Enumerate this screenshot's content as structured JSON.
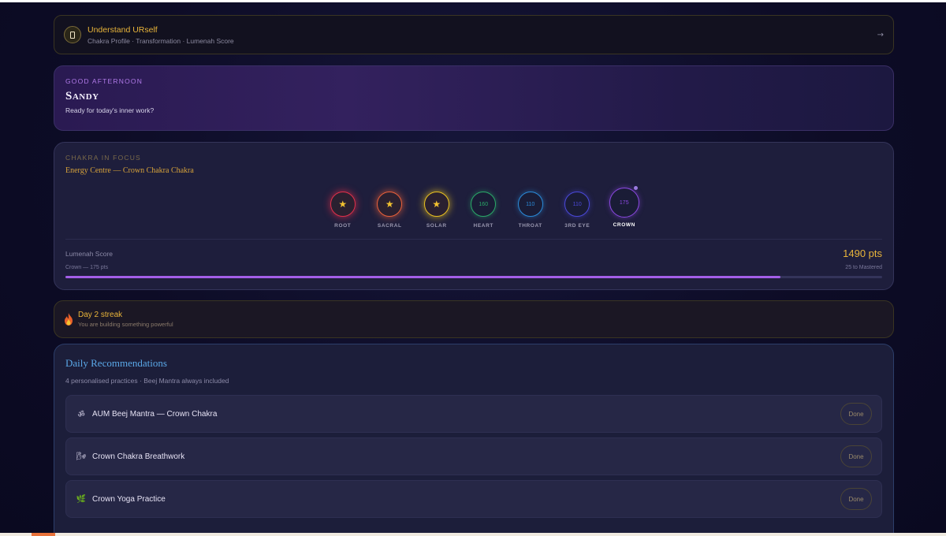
{
  "banner": {
    "title": "Understand URself",
    "subtitle": "Chakra Profile · Transformation · Lumenah Score",
    "arrow": "→"
  },
  "greeting": {
    "label": "GOOD AFTERNOON",
    "name": "Sandy",
    "subtitle": "Ready for today's inner work?"
  },
  "chakra_focus": {
    "label": "CHAKRA IN FOCUS",
    "subtitle": "Energy Centre — Crown Chakra Chakra",
    "chakras": [
      {
        "name": "ROOT",
        "value": "★",
        "color": "#e0304a",
        "mastered": true
      },
      {
        "name": "SACRAL",
        "value": "★",
        "color": "#e8603a",
        "mastered": true
      },
      {
        "name": "SOLAR",
        "value": "★",
        "color": "#e8c020",
        "mastered": true
      },
      {
        "name": "HEART",
        "value": "160",
        "color": "#2aa868",
        "mastered": false
      },
      {
        "name": "THROAT",
        "value": "110",
        "color": "#2a8ad8",
        "mastered": false
      },
      {
        "name": "3RD EYE",
        "value": "110",
        "color": "#4a48d8",
        "mastered": false
      },
      {
        "name": "CROWN",
        "value": "175",
        "color": "#8a48e0",
        "mastered": false,
        "active": true
      }
    ],
    "score_label": "Lumenah Score",
    "score_value": "1490 pts",
    "current": "Crown — 175 pts",
    "to_mastered": "25 to Mastered",
    "progress": 0.875
  },
  "streak": {
    "title": "Day 2 streak",
    "subtitle": "You are building something powerful"
  },
  "recommendations": {
    "title": "Daily Recommendations",
    "subtitle": "4 personalised practices · Beej Mantra always included",
    "done_label": "Done",
    "items": [
      {
        "icon": "ॐ",
        "icon_name": "om-icon",
        "label": "AUM Beej Mantra — Crown Chakra"
      },
      {
        "icon": "🌬",
        "icon_name": "wind-icon",
        "label": "Crown Chakra Breathwork"
      },
      {
        "icon": "🌿",
        "icon_name": "herb-icon",
        "label": "Crown Yoga Practice"
      }
    ]
  }
}
